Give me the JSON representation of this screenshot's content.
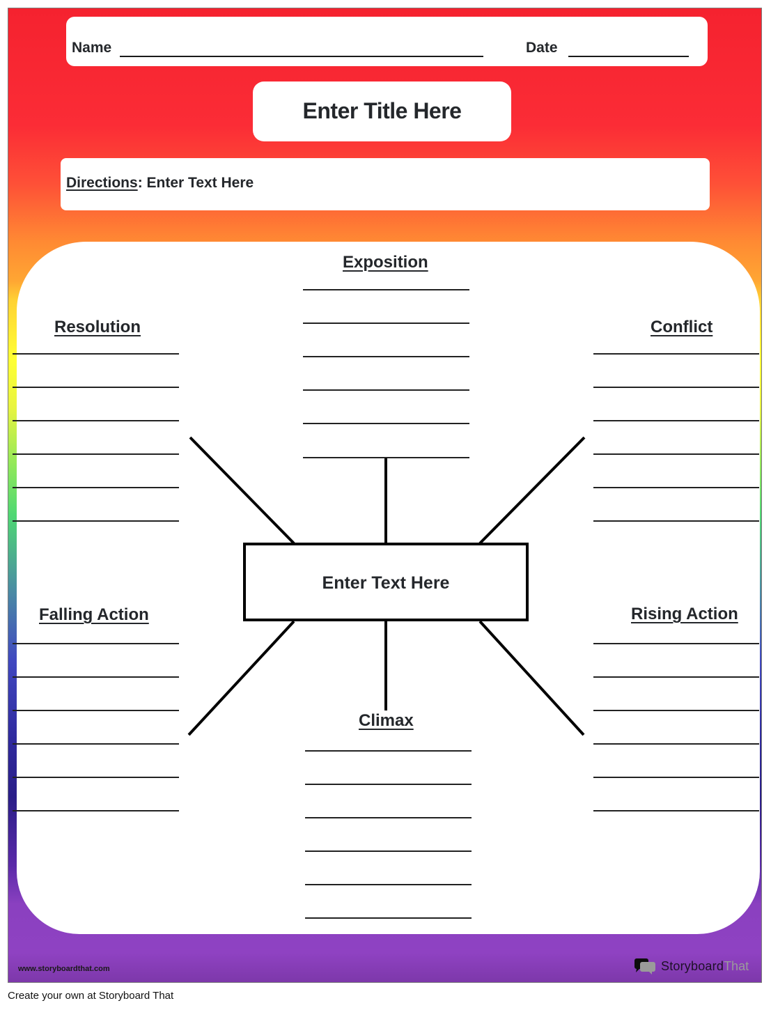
{
  "header": {
    "name_label": "Name",
    "date_label": "Date"
  },
  "title": "Enter Title Here",
  "directions": {
    "label": "Directions",
    "separator": ":",
    "text": " Enter Text Here"
  },
  "center": {
    "text": "Enter Text Here"
  },
  "sections": {
    "exposition": {
      "heading": "Exposition",
      "line_count": 6
    },
    "conflict": {
      "heading": "Conflict",
      "line_count": 6
    },
    "rising_action": {
      "heading": "Rising Action",
      "line_count": 6
    },
    "climax": {
      "heading": "Climax",
      "line_count": 6
    },
    "falling_action": {
      "heading": "Falling Action",
      "line_count": 6
    },
    "resolution": {
      "heading": "Resolution",
      "line_count": 6
    }
  },
  "branding": {
    "website": "www.storyboardthat.com",
    "logo_part1": "Storyboard",
    "logo_part2": "That",
    "footer_text": "Create your own at Storyboard That"
  },
  "colors": {
    "gradient_top": "#f5222f",
    "gradient_orange": "#ff8a33",
    "gradient_yellow": "#ffff33",
    "gradient_green": "#4fd873",
    "gradient_blue": "#4048c0",
    "gradient_purple": "#8f42c2",
    "text_dark": "#24272b"
  }
}
